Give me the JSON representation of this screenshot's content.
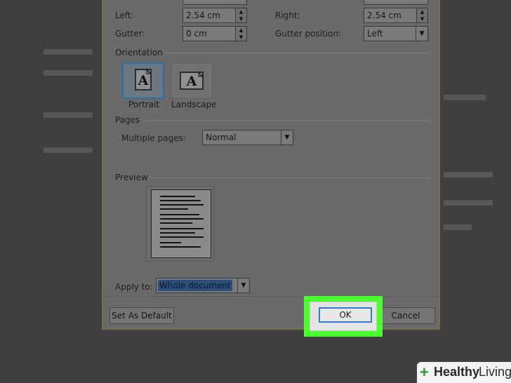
{
  "margins": {
    "left_label": "Left:",
    "left_value": "2.54 cm",
    "right_label": "Right:",
    "right_value": "2.54 cm",
    "gutter_label": "Gutter:",
    "gutter_value": "0 cm",
    "gutter_position_label": "Gutter position:",
    "gutter_position_value": "Left"
  },
  "orientation": {
    "section_label": "Orientation",
    "portrait_glyph": "A",
    "landscape_glyph": "A",
    "portrait_label": "Portrait",
    "landscape_label": "Landscape",
    "selected": "Portrait"
  },
  "pages": {
    "section_label": "Pages",
    "multiple_pages_label": "Multiple pages:",
    "multiple_pages_value": "Normal"
  },
  "preview": {
    "section_label": "Preview"
  },
  "apply": {
    "label": "Apply to:",
    "value": "Whole document"
  },
  "buttons": {
    "set_default": "Set As Default",
    "ok": "OK",
    "cancel": "Cancel"
  },
  "watermark": {
    "brand_bold": "Healthy",
    "brand_light": "Living"
  },
  "colors": {
    "highlight": "#4cff2e",
    "selection_border": "#2f6da6",
    "ok_focus": "#2b7bd0",
    "brand_green": "#2e9a3b"
  },
  "icons": {
    "spin_up": "▲",
    "spin_down": "▼",
    "dropdown": "▼",
    "brand_plus": "+"
  }
}
